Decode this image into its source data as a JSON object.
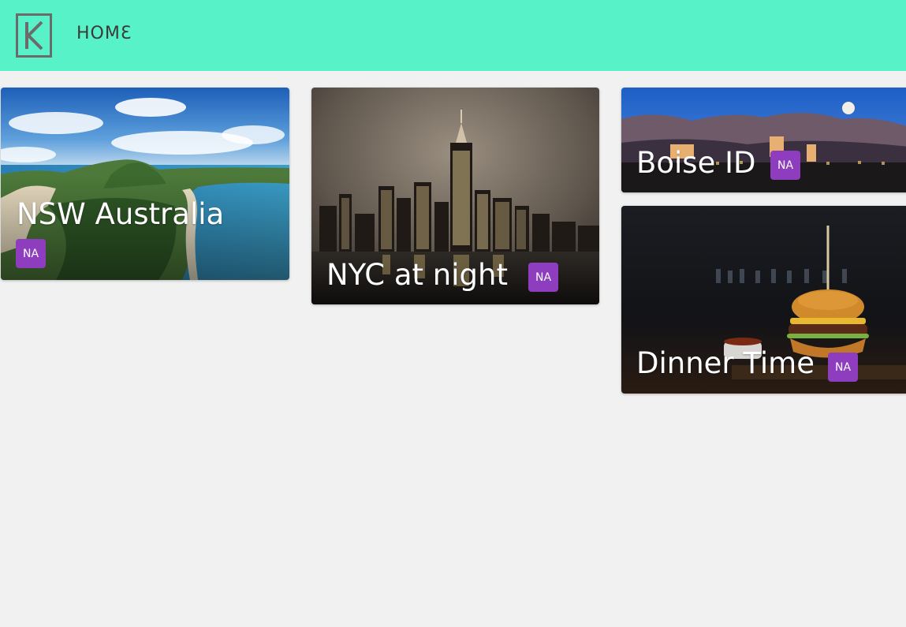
{
  "colors": {
    "brand": "#58f2c8",
    "badge": "#8e3dbf",
    "background": "#f1f1f1"
  },
  "header": {
    "logo_letter": "K",
    "logo_icon": "k-logo-icon",
    "nav_home": "HOMƐ"
  },
  "cards": [
    {
      "title": "NSW Australia",
      "badge": "NA",
      "image": "coastline-photo"
    },
    {
      "title": "NYC at night",
      "badge": "NA",
      "image": "city-skyline-photo"
    },
    {
      "title": "Boise ID",
      "badge": "NA",
      "image": "mountain-city-photo"
    },
    {
      "title": "Dinner Time",
      "badge": "NA",
      "image": "burger-photo"
    }
  ]
}
